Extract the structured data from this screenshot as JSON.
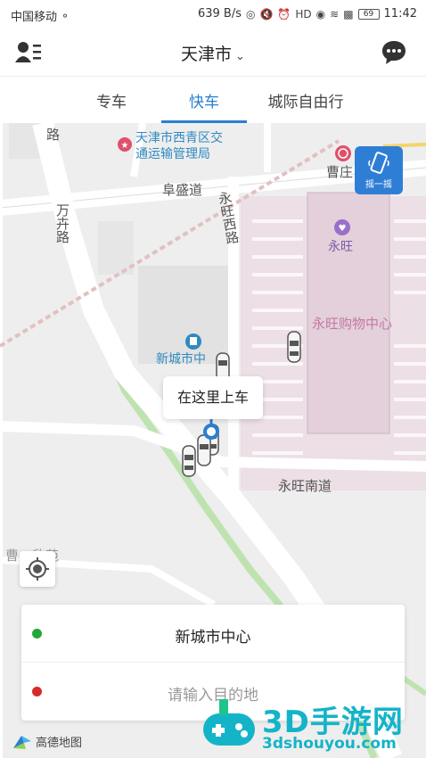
{
  "status_bar": {
    "carrier": "中国移动",
    "net_speed": "639 B/s",
    "battery": "69",
    "time": "11:42"
  },
  "header": {
    "city": "天津市"
  },
  "tabs": [
    {
      "label": "专车"
    },
    {
      "label": "快车"
    },
    {
      "label": "城际自由行"
    }
  ],
  "map": {
    "roads": [
      "阜盛道",
      "万卉路",
      "永旺西路",
      "永旺南道",
      "路",
      "曹庄"
    ],
    "poi_traffic": "天津市西青区交\n通运输管理局",
    "poi_aeon": "永旺",
    "mall": "永旺购物中心",
    "poi_center": "新城市中",
    "residence": "曹…欣苑",
    "shake_label": "摇一摇",
    "pickup_hint": "在这里上车",
    "logo": "高德地图"
  },
  "route": {
    "start": "新城市中心",
    "destination_placeholder": "请输入目的地"
  },
  "colors": {
    "accent": "#2a7fd0",
    "start_dot": "#22a83a",
    "end_dot": "#d62b2b"
  },
  "watermark": {
    "title": "3D手游网",
    "url": "3dshouyou.com"
  }
}
